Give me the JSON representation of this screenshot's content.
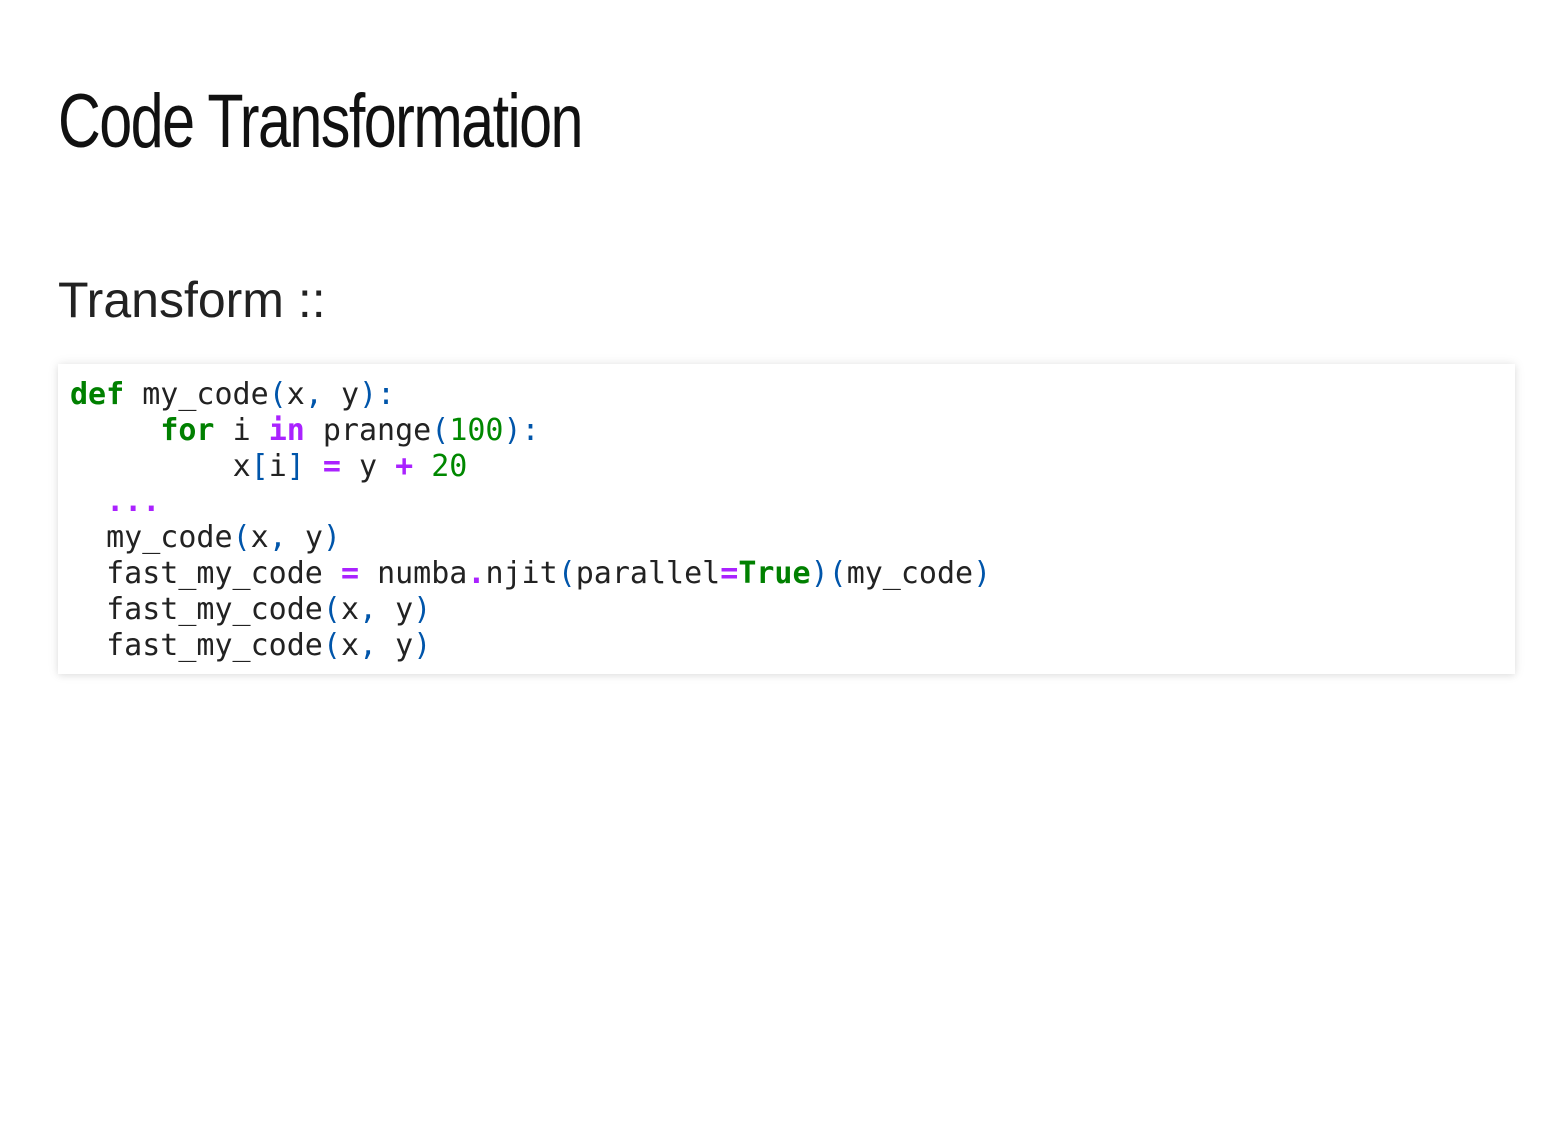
{
  "slide": {
    "title": "Code Transformation",
    "intro": "Transform ::"
  },
  "code": {
    "language": "python",
    "colors": {
      "keyword": "#008000",
      "operator": "#aa22ff",
      "punctuation": "#0055aa",
      "number": "#008800",
      "text": "#222222"
    },
    "lines": [
      [
        {
          "t": "def",
          "c": "kw"
        },
        {
          "t": " ",
          "c": "ws"
        },
        {
          "t": "my_code",
          "c": "n"
        },
        {
          "t": "(",
          "c": "p"
        },
        {
          "t": "x",
          "c": "n"
        },
        {
          "t": ",",
          "c": "p"
        },
        {
          "t": " ",
          "c": "ws"
        },
        {
          "t": "y",
          "c": "n"
        },
        {
          "t": "):",
          "c": "p"
        }
      ],
      [
        {
          "t": "     ",
          "c": "ws"
        },
        {
          "t": "for",
          "c": "kw"
        },
        {
          "t": " ",
          "c": "ws"
        },
        {
          "t": "i",
          "c": "n"
        },
        {
          "t": " ",
          "c": "ws"
        },
        {
          "t": "in",
          "c": "kwop"
        },
        {
          "t": " ",
          "c": "ws"
        },
        {
          "t": "prange",
          "c": "n"
        },
        {
          "t": "(",
          "c": "p"
        },
        {
          "t": "100",
          "c": "num"
        },
        {
          "t": "):",
          "c": "p"
        }
      ],
      [
        {
          "t": "         ",
          "c": "ws"
        },
        {
          "t": "x",
          "c": "n"
        },
        {
          "t": "[",
          "c": "p"
        },
        {
          "t": "i",
          "c": "n"
        },
        {
          "t": "]",
          "c": "p"
        },
        {
          "t": " ",
          "c": "ws"
        },
        {
          "t": "=",
          "c": "op"
        },
        {
          "t": " ",
          "c": "ws"
        },
        {
          "t": "y",
          "c": "n"
        },
        {
          "t": " ",
          "c": "ws"
        },
        {
          "t": "+",
          "c": "op"
        },
        {
          "t": " ",
          "c": "ws"
        },
        {
          "t": "20",
          "c": "num"
        }
      ],
      [
        {
          "t": "  ",
          "c": "ws"
        },
        {
          "t": "...",
          "c": "op"
        }
      ],
      [
        {
          "t": "  ",
          "c": "ws"
        },
        {
          "t": "my_code",
          "c": "n"
        },
        {
          "t": "(",
          "c": "p"
        },
        {
          "t": "x",
          "c": "n"
        },
        {
          "t": ",",
          "c": "p"
        },
        {
          "t": " ",
          "c": "ws"
        },
        {
          "t": "y",
          "c": "n"
        },
        {
          "t": ")",
          "c": "p"
        }
      ],
      [
        {
          "t": "  ",
          "c": "ws"
        },
        {
          "t": "fast_my_code",
          "c": "n"
        },
        {
          "t": " ",
          "c": "ws"
        },
        {
          "t": "=",
          "c": "op"
        },
        {
          "t": " ",
          "c": "ws"
        },
        {
          "t": "numba",
          "c": "n"
        },
        {
          "t": ".",
          "c": "op"
        },
        {
          "t": "njit",
          "c": "n"
        },
        {
          "t": "(",
          "c": "p"
        },
        {
          "t": "parallel",
          "c": "n"
        },
        {
          "t": "=",
          "c": "op"
        },
        {
          "t": "True",
          "c": "kw"
        },
        {
          "t": ")(",
          "c": "p"
        },
        {
          "t": "my_code",
          "c": "n"
        },
        {
          "t": ")",
          "c": "p"
        }
      ],
      [
        {
          "t": "  ",
          "c": "ws"
        },
        {
          "t": "fast_my_code",
          "c": "n"
        },
        {
          "t": "(",
          "c": "p"
        },
        {
          "t": "x",
          "c": "n"
        },
        {
          "t": ",",
          "c": "p"
        },
        {
          "t": " ",
          "c": "ws"
        },
        {
          "t": "y",
          "c": "n"
        },
        {
          "t": ")",
          "c": "p"
        }
      ],
      [
        {
          "t": "  ",
          "c": "ws"
        },
        {
          "t": "fast_my_code",
          "c": "n"
        },
        {
          "t": "(",
          "c": "p"
        },
        {
          "t": "x",
          "c": "n"
        },
        {
          "t": ",",
          "c": "p"
        },
        {
          "t": " ",
          "c": "ws"
        },
        {
          "t": "y",
          "c": "n"
        },
        {
          "t": ")",
          "c": "p"
        }
      ]
    ]
  }
}
